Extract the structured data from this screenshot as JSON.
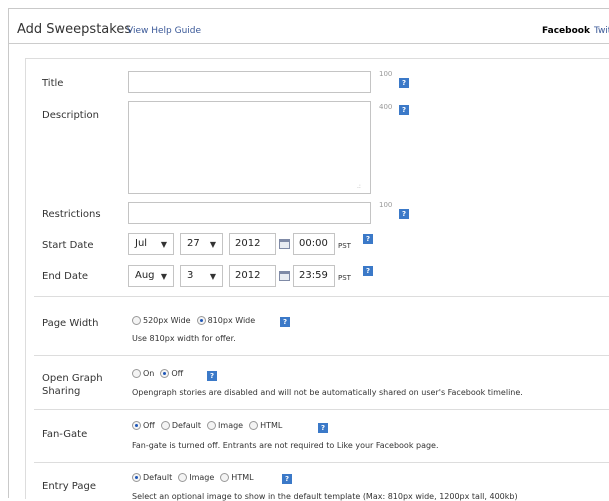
{
  "header": {
    "title": "Add Sweepstakes",
    "help_link": "View Help Guide",
    "tab_active": "Facebook",
    "tab_next": "Twit"
  },
  "form": {
    "title": {
      "label": "Title",
      "value": "",
      "count": "100",
      "help": "?"
    },
    "description": {
      "label": "Description",
      "value": "",
      "count": "400",
      "help": "?"
    },
    "restrictions": {
      "label": "Restrictions",
      "value": "",
      "count": "100",
      "help": "?"
    },
    "start_date": {
      "label": "Start Date",
      "month": "Jul",
      "day": "27",
      "year": "2012",
      "time": "00:00",
      "tz": "PST",
      "help": "?"
    },
    "end_date": {
      "label": "End Date",
      "month": "Aug",
      "day": "3",
      "year": "2012",
      "time": "23:59",
      "tz": "PST",
      "help": "?"
    },
    "page_width": {
      "label": "Page Width",
      "options": [
        "520px Wide",
        "810px Wide"
      ],
      "selected": "810px Wide",
      "help": "?",
      "hint": "Use 810px width for offer."
    },
    "open_graph": {
      "label_line1": "Open Graph",
      "label_line2": "Sharing",
      "options": [
        "On",
        "Off"
      ],
      "selected": "Off",
      "help": "?",
      "hint": "Opengraph stories are disabled and will not be automatically shared on user's Facebook timeline."
    },
    "fan_gate": {
      "label": "Fan-Gate",
      "options": [
        "Off",
        "Default",
        "Image",
        "HTML"
      ],
      "selected": "Off",
      "help": "?",
      "hint": "Fan-gate is turned off. Entrants are not required to Like your Facebook page."
    },
    "entry_page": {
      "label": "Entry Page",
      "options": [
        "Default",
        "Image",
        "HTML"
      ],
      "selected": "Default",
      "help": "?",
      "hint": "Select an optional image to show in the default template (Max: 810px wide, 1200px tall, 400kb)"
    }
  },
  "icons": {
    "dropdown": "chevron-down-icon",
    "calendar": "calendar-icon",
    "help": "help-icon",
    "resize": "resize-grip-icon"
  },
  "colors": {
    "link": "#3b5998",
    "help_icon": "#3b79c8",
    "border": "#c4c4c4"
  }
}
